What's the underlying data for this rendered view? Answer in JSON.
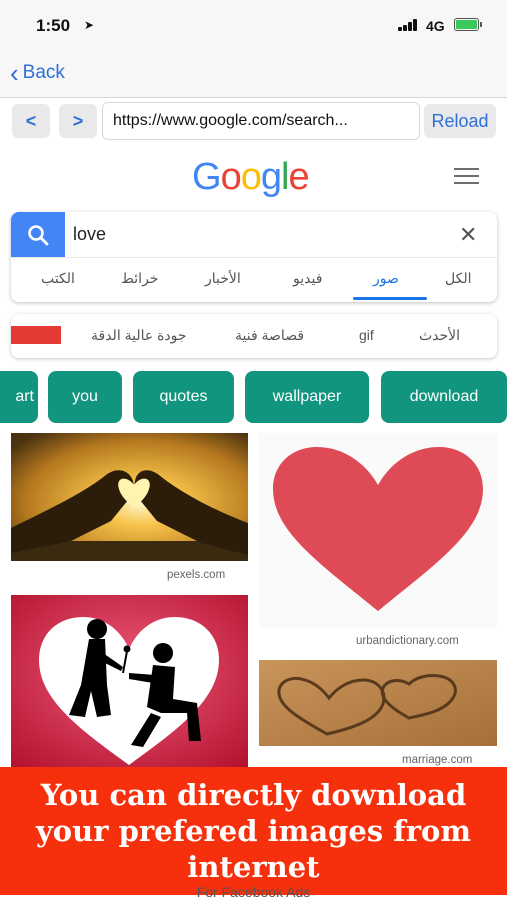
{
  "status_bar": {
    "time": "1:50",
    "network": "4G"
  },
  "nav": {
    "back_label": "Back"
  },
  "browser": {
    "prev_label": "<",
    "next_label": ">",
    "url": "https://www.google.com/search...",
    "reload_label": "Reload"
  },
  "google": {
    "logo_letters": [
      "G",
      "o",
      "o",
      "g",
      "l",
      "e"
    ],
    "search_query": "love",
    "tabs": [
      "الكل",
      "صور",
      "فيديو",
      "الأخبار",
      "خرائط",
      "الكتب"
    ],
    "active_tab": "صور"
  },
  "filters": {
    "items": [
      "الأحدث",
      "gif",
      "قصاصة فنية",
      "جودة عالية الدقة"
    ],
    "color_swatch": "#e53935"
  },
  "chips": [
    "art",
    "you",
    "quotes",
    "wallpaper",
    "download"
  ],
  "results": [
    {
      "source": "pexels.com",
      "image": "hands-heart-sunset"
    },
    {
      "source": "urbandictionary.com",
      "image": "red-heart"
    },
    {
      "source": "",
      "image": "couple-silhouette-heart"
    },
    {
      "source": "marriage.com",
      "image": "sand-hearts"
    }
  ],
  "banner": {
    "lines": [
      "You can directly download",
      "your prefered images from",
      "internet"
    ]
  },
  "footer_peek": "For Facebook Ads",
  "colors": {
    "accent": "#2e6fd8",
    "google_blue": "#4285f4",
    "chip_teal": "#11957f",
    "banner_red": "#f6300d"
  }
}
